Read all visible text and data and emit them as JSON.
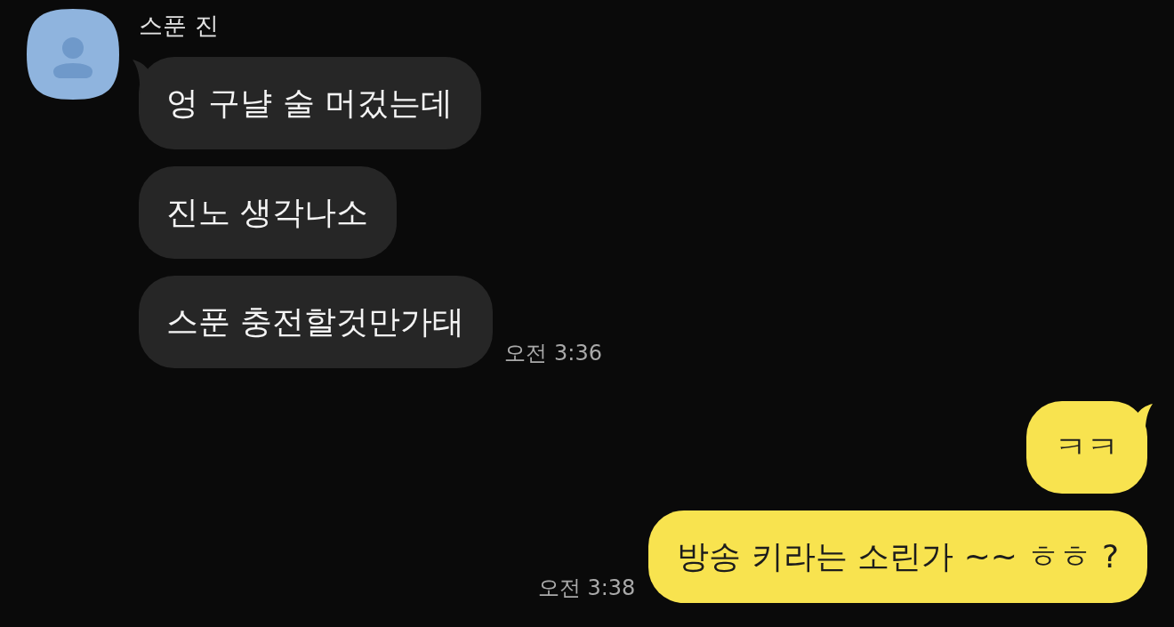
{
  "conversation": [
    {
      "kind": "received",
      "sender": {
        "name": "스푼 진"
      },
      "messages": [
        {
          "text": "엉 구냘 술 머겄는데",
          "tail": true
        },
        {
          "text": "진노 생각나소",
          "tail": false
        },
        {
          "text": "스푼 충전할것만가태",
          "tail": false,
          "time": "오전 3:36"
        }
      ]
    },
    {
      "kind": "sent",
      "messages": [
        {
          "text": "ㅋㅋ",
          "tail": true
        },
        {
          "text": "방송 키라는 소린가 ~~ ㅎㅎ ?",
          "tail": false,
          "time": "오전 3:38"
        }
      ]
    }
  ]
}
